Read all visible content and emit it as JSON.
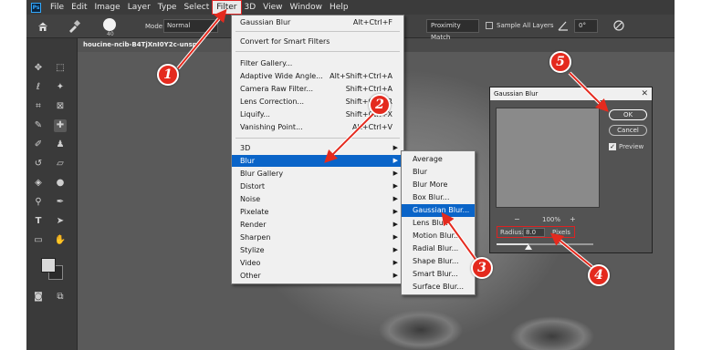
{
  "menubar": {
    "app_icon": "Ps",
    "items": [
      "File",
      "Edit",
      "Image",
      "Layer",
      "Type",
      "Select",
      "Filter",
      "3D",
      "View",
      "Window",
      "Help"
    ]
  },
  "options_bar": {
    "brush_size": "40",
    "mode_label": "Mode:",
    "mode_value": "Normal",
    "proximity": "Proximity Match",
    "sample_label": "Sample All Layers",
    "angle_value": "0°"
  },
  "document": {
    "tab_title": "houcine-ncib-B4TjXnI0Y2c-unspl"
  },
  "filter_menu": {
    "last_filter": "Gaussian Blur",
    "last_filter_shortcut": "Alt+Ctrl+F",
    "smart": "Convert for Smart Filters",
    "items": [
      {
        "label": "Filter Gallery...",
        "shortcut": ""
      },
      {
        "label": "Adaptive Wide Angle...",
        "shortcut": "Alt+Shift+Ctrl+A"
      },
      {
        "label": "Camera Raw Filter...",
        "shortcut": "Shift+Ctrl+A"
      },
      {
        "label": "Lens Correction...",
        "shortcut": "Shift+Ctrl+R"
      },
      {
        "label": "Liquify...",
        "shortcut": "Shift+Ctrl+X"
      },
      {
        "label": "Vanishing Point...",
        "shortcut": "Alt+Ctrl+V"
      }
    ],
    "groups": [
      "3D",
      "Blur",
      "Blur Gallery",
      "Distort",
      "Noise",
      "Pixelate",
      "Render",
      "Sharpen",
      "Stylize",
      "Video",
      "Other"
    ],
    "highlighted": "Blur"
  },
  "blur_menu": {
    "items": [
      "Average",
      "Blur",
      "Blur More",
      "Box Blur...",
      "Gaussian Blur...",
      "Lens Blur...",
      "Motion Blur...",
      "Radial Blur...",
      "Shape Blur...",
      "Smart Blur...",
      "Surface Blur..."
    ],
    "highlighted": "Gaussian Blur..."
  },
  "dialog": {
    "title": "Gaussian Blur",
    "close": "✕",
    "ok": "OK",
    "cancel": "Cancel",
    "preview_label": "Preview",
    "preview_checked": true,
    "zoom_out": "−",
    "zoom": "100%",
    "zoom_in": "+",
    "radius_label": "Radius:",
    "radius_value": "8.0",
    "radius_unit": "Pixels",
    "slider_fraction": 0.33
  },
  "annotations": [
    "1",
    "2",
    "3",
    "4",
    "5"
  ],
  "colors": {
    "accent": "#0a64c8",
    "annotation": "#e42a1e",
    "ps_blue": "#31a8ff"
  }
}
